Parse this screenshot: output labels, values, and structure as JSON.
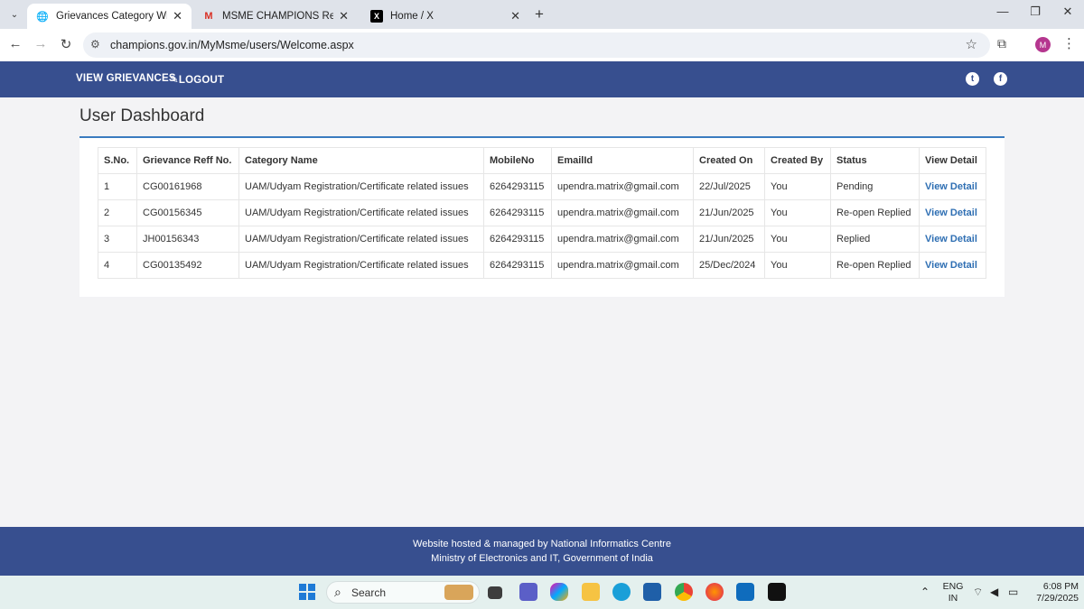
{
  "browser": {
    "tabs": [
      {
        "title": "Grievances Category Wise",
        "favicon": "globe-icon",
        "active": true
      },
      {
        "title": "MSME CHAMPIONS Reference",
        "favicon": "gmail-icon",
        "active": false
      },
      {
        "title": "Home / X",
        "favicon": "x-logo-icon",
        "active": false
      }
    ],
    "url": "champions.gov.in/MyMsme/users/Welcome.aspx",
    "profile_initial": "M"
  },
  "site": {
    "nav": {
      "view_grievances": "VIEW GRIEVANCES",
      "logout": "LOGOUT"
    },
    "page_title": "User Dashboard",
    "table": {
      "headers": [
        "S.No.",
        "Grievance Reff No.",
        "Category Name",
        "MobileNo",
        "EmailId",
        "Created On",
        "Created By",
        "Status",
        "View Detail"
      ],
      "rows": [
        [
          "1",
          "CG00161968",
          "UAM/Udyam Registration/Certificate related issues",
          "6264293115",
          "upendra.matrix@gmail.com",
          "22/Jul/2025",
          "You",
          "Pending",
          "View Detail"
        ],
        [
          "2",
          "CG00156345",
          "UAM/Udyam Registration/Certificate related issues",
          "6264293115",
          "upendra.matrix@gmail.com",
          "21/Jun/2025",
          "You",
          "Re-open Replied",
          "View Detail"
        ],
        [
          "3",
          "JH00156343",
          "UAM/Udyam Registration/Certificate related issues",
          "6264293115",
          "upendra.matrix@gmail.com",
          "21/Jun/2025",
          "You",
          "Replied",
          "View Detail"
        ],
        [
          "4",
          "CG00135492",
          "UAM/Udyam Registration/Certificate related issues",
          "6264293115",
          "upendra.matrix@gmail.com",
          "25/Dec/2024",
          "You",
          "Re-open Replied",
          "View Detail"
        ]
      ]
    },
    "footer": {
      "line1": "Website hosted & managed by National Informatics Centre",
      "line2": "Ministry of Electronics and IT, Government of India"
    }
  },
  "taskbar": {
    "search_placeholder": "Search",
    "language": "ENG",
    "region": "IN",
    "time": "6:08 PM",
    "date": "7/29/2025"
  },
  "colors": {
    "nav_bg": "#374f8f",
    "accent": "#3a7bbf",
    "link": "#2f6fb3"
  }
}
